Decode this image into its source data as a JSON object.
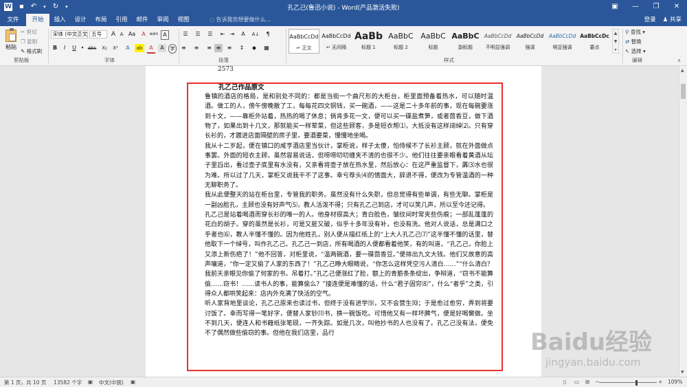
{
  "window": {
    "title": "孔乙己(鲁迅小说) - Word(产品激活失败)",
    "qa_icons": [
      "word-icon",
      "save-icon",
      "undo-icon",
      "redo-icon",
      "customize-icon"
    ],
    "minimize": "—",
    "restore": "❐",
    "close": "✕",
    "ribbon_options": "▣"
  },
  "tabs": [
    "文件",
    "开始",
    "插入",
    "设计",
    "布局",
    "引用",
    "邮件",
    "审阅",
    "视图"
  ],
  "tell_me": "告诉我您想要做什么...",
  "signin": "登录",
  "share": "共享",
  "clipboard": {
    "paste": "粘贴",
    "cut": "剪切",
    "copy": "复制",
    "format_painter": "格式刷",
    "label": "剪贴板"
  },
  "font": {
    "name": "宋体 (中文正文)",
    "size": "五号",
    "grow": "A",
    "shrink": "A",
    "case": "Aa",
    "clear": "A",
    "phonetic": "wén",
    "border": "A",
    "bold": "B",
    "italic": "I",
    "underline": "U",
    "strike": "abc",
    "subscript": "X₂",
    "superscript": "X²",
    "effects": "A",
    "highlight": "ab",
    "color": "A",
    "shading": "A",
    "enclose": "字",
    "label": "字体"
  },
  "paragraph": {
    "bullets": "☰",
    "numbering": "☰",
    "multilevel": "☰",
    "decrease_indent": "⇤",
    "increase_indent": "⇥",
    "chinese_layout": "A",
    "sort": "A↓",
    "show_marks": "¶",
    "align_left": "≡",
    "center": "≡",
    "align_right": "≡",
    "justify": "≡",
    "distribute": "≡",
    "line_spacing": "↕",
    "shading": "◆",
    "borders": "▦",
    "label": "段落"
  },
  "styles": {
    "items": [
      {
        "sample": "AaBbCcDd",
        "name": "↵ 正文"
      },
      {
        "sample": "AaBbCcDd",
        "name": "↵ 无间隔"
      },
      {
        "sample": "AaBb",
        "name": "标题 1"
      },
      {
        "sample": "AaBbC",
        "name": "标题 2"
      },
      {
        "sample": "AaBbC",
        "name": "标题"
      },
      {
        "sample": "AaBbC",
        "name": "副标题"
      },
      {
        "sample": "AaBbCcDd",
        "name": "不明显强调"
      },
      {
        "sample": "AaBbCcDd",
        "name": "强调"
      },
      {
        "sample": "AaBbCcDd",
        "name": "明显强调"
      },
      {
        "sample": "AaBbCcDc",
        "name": "要点"
      }
    ],
    "label": "样式"
  },
  "editing": {
    "find": "查找",
    "replace": "替换",
    "select": "选择",
    "label": "编辑"
  },
  "document": {
    "page_number": "2573",
    "title": "孔乙己作品原文",
    "paragraphs": [
      "鲁镇的酒店的格局，是和别处不同的：都是当街一个曲尺形的大柜台，柜里面预备着热水，可以随时温酒。做工的人，傍午傍晚散了工，每每花四文铜钱，买一碗酒，——这是二十多年前的事，现在每碗要涨到十文，——靠柜外站着，热热的喝了休息；倘肯多花一文，便可以买一碟盐煮笋，或者茴香豆，做下酒物了，如果出到十几文，那就能买一样荤菜，但这些顾客，多是短衣帮⑴，大抵没有这样阔绰⑵。只有穿长衫的，才踱进店面隔壁的房子里，要酒要菜，慢慢地坐喝。",
      "我从十二岁起，便在镇口的咸亨酒店里当伙计，掌柜说，样子太傻，怕侍候不了长衫主顾，就在外面做点事罢。外面的短衣主顾，虽然容易说话，但唠唠叨叨缠夹不清的也很不少。他们往往要亲眼看着黄酒从坛子里舀出，看过壶子底里有水没有，又亲看将壶子放在热水里，然后放心：在这严重监督下，羼⑶水也很为难。所以过了几天，掌柜又说我干不了这事。幸亏荐头⑷的情面大，辞退不得，便改为专管温酒的一种无聊职务了。",
      "我从此便整天的站在柜台里，专管我的职务。虽然没有什么失职，但总觉得有些单调，有些无聊。掌柜是一副凶脸孔，主顾也没有好声气⑸，教人活泼不得；只有孔乙己到店，才可以笑几声，所以至今还记得。",
      "孔乙己是站着喝酒而穿长衫的唯一的人。他身材很高大；青白脸色，皱纹间时常夹些伤痕；一部乱蓬蓬的花白的胡子。穿的虽然是长衫，可是又脏又破，似乎十多年没有补，也没有洗。他对人说话，总是满口之乎者也⑹，教人半懂不懂的。因为他姓孔，别人便从描红纸上的“上大人孔乙己⑺”这半懂不懂的话里，替他取下一个绰号，叫作孔乙己。孔乙己一到店，所有喝酒的人便都看着他笑，有的叫道，“孔乙己，你脸上又添上新伤疤了！”他不回答，对柜里说，“温两碗酒，要一碟茴香豆。”便排出九文大钱。他们又故意的高声嚷道，“你一定又偷了人家的东西了！”孔乙己睁大眼睛说，“你怎么这样凭空污人清白……”“什么清白？我前天亲眼见你偷了何家的书，吊着打。”孔乙己便涨红了脸，额上的青筋条条绽出，争辩道，“窃书不能算偷……窃书！……读书人的事，能算偷么？”接连便是难懂的话，什么“君子固穷⑻”，什么“者乎”之类，引得众人都哄笑起来：店内外充满了快活的空气。",
      "听人家背地里谈论，孔乙己原来也读过书，但终于没有进学⑼，又不会营生⑽；于是愈过愈穷，弄到将要讨饭了。幸而写得一笔好字，便替人家钞⑾书，换一碗饭吃。可惜他又有一样坏脾气，便是好喝懒做。坐不到几天，便连人和书籍纸张笔砚，一齐失踪。如是几次，叫他抄书的人也没有了。孔乙己没有法，便免不了偶然做些偷窃的事。但他在我们店里，品行"
    ]
  },
  "statusbar": {
    "page": "第 1 页，共 10 页",
    "words": "13582 个字",
    "proof_icon": "▣",
    "language": "中文(中国)",
    "macro_icon": "▣",
    "view_read": "▯",
    "view_print": "▭",
    "view_web": "⊞",
    "zoom_out": "−",
    "zoom_in": "+",
    "zoom": "109%"
  },
  "watermark": {
    "text": "Baidu经验",
    "sub": "jingyan.baidu.com"
  }
}
